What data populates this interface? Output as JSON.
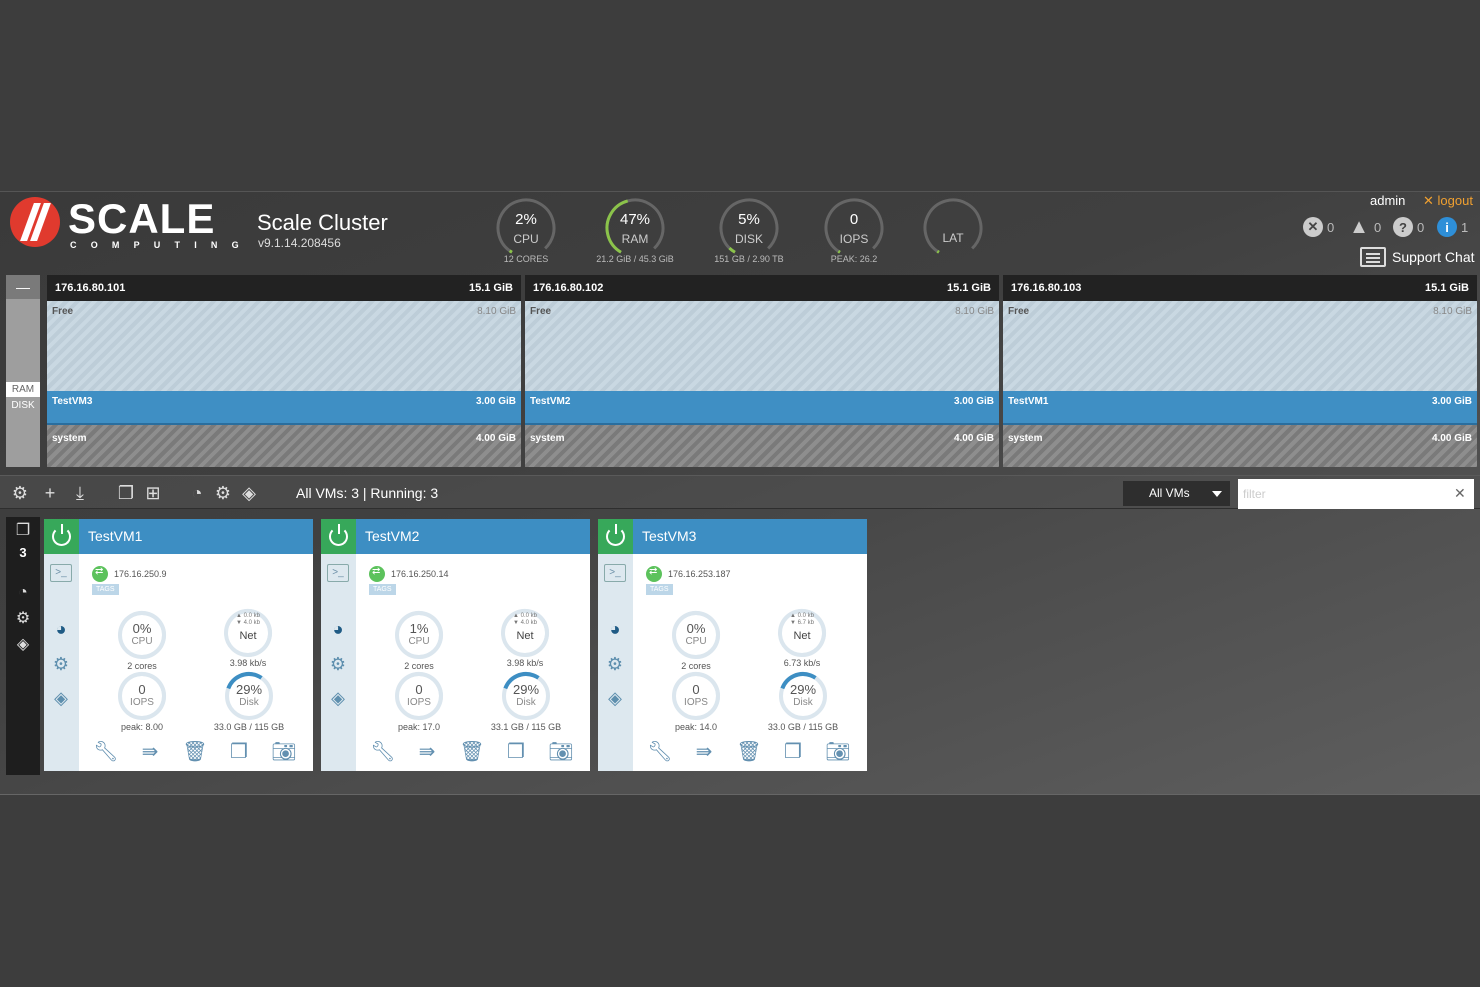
{
  "brand": {
    "name": "SCALE",
    "sub": "COMPUTING"
  },
  "cluster": {
    "name": "Scale Cluster",
    "version": "v9.1.14.208456"
  },
  "gauges": [
    {
      "id": "cpu",
      "value": "2%",
      "label": "CPU",
      "sub": "12 CORES",
      "fraction": 0.02
    },
    {
      "id": "ram",
      "value": "47%",
      "label": "RAM",
      "sub": "21.2 GiB / 45.3 GiB",
      "fraction": 0.47
    },
    {
      "id": "disk",
      "value": "5%",
      "label": "DISK",
      "sub": "151 GB / 2.90 TB",
      "fraction": 0.05
    },
    {
      "id": "iops",
      "value": "0",
      "label": "IOPS",
      "sub": "PEAK: 26.2",
      "fraction": 0.0
    },
    {
      "id": "lat",
      "value": "",
      "label": "LAT",
      "sub": "",
      "fraction": 0.0
    }
  ],
  "user": {
    "name": "admin",
    "logout": "logout"
  },
  "alerts": {
    "errors": "0",
    "warnings": "0",
    "questions": "0",
    "info": "1"
  },
  "support": {
    "label": "Support Chat"
  },
  "ram_panel": {
    "tabs": {
      "collapse": "—",
      "ram": "RAM",
      "disk": "DISK"
    },
    "nodes": [
      {
        "ip": "176.16.80.101",
        "total": "15.1 GiB",
        "free_label": "Free",
        "free": "8.10 GiB",
        "vm": "TestVM3",
        "vm_size": "3.00 GiB",
        "sys_label": "system",
        "sys": "4.00 GiB"
      },
      {
        "ip": "176.16.80.102",
        "total": "15.1 GiB",
        "free_label": "Free",
        "free": "8.10 GiB",
        "vm": "TestVM2",
        "vm_size": "3.00 GiB",
        "sys_label": "system",
        "sys": "4.00 GiB"
      },
      {
        "ip": "176.16.80.103",
        "total": "15.1 GiB",
        "free_label": "Free",
        "free": "8.10 GiB",
        "vm": "TestVM1",
        "vm_size": "3.00 GiB",
        "sys_label": "system",
        "sys": "4.00 GiB"
      }
    ]
  },
  "toolbar": {
    "summary": "All VMs: 3 | Running: 3",
    "select_value": "All VMs",
    "filter_placeholder": "filter",
    "filter_clear": "✕"
  },
  "strip": {
    "count": "3"
  },
  "vms": [
    {
      "name": "TestVM1",
      "ip": "176.16.250.9",
      "tags": "TAGS",
      "cpu": "0%",
      "cpu_label": "CPU",
      "cores": "2 cores",
      "net_up": "▲ 0.0 kb",
      "net_down": "▼ 4.0 kb",
      "net_label": "Net",
      "net_rate": "3.98 kb/s",
      "iops": "0",
      "iops_label": "IOPS",
      "iops_peak": "peak: 8.00",
      "disk": "29%",
      "disk_label": "Disk",
      "disk_usage": "33.0 GB / 115 GB",
      "disk_fraction": 0.29
    },
    {
      "name": "TestVM2",
      "ip": "176.16.250.14",
      "tags": "TAGS",
      "cpu": "1%",
      "cpu_label": "CPU",
      "cores": "2 cores",
      "net_up": "▲ 0.0 kb",
      "net_down": "▼ 4.0 kb",
      "net_label": "Net",
      "net_rate": "3.98 kb/s",
      "iops": "0",
      "iops_label": "IOPS",
      "iops_peak": "peak: 17.0",
      "disk": "29%",
      "disk_label": "Disk",
      "disk_usage": "33.1 GB / 115 GB",
      "disk_fraction": 0.29
    },
    {
      "name": "TestVM3",
      "ip": "176.16.253.187",
      "tags": "TAGS",
      "cpu": "0%",
      "cpu_label": "CPU",
      "cores": "2 cores",
      "net_up": "▲ 0.0 kb",
      "net_down": "▼ 6.7 kb",
      "net_label": "Net",
      "net_rate": "6.73 kb/s",
      "iops": "0",
      "iops_label": "IOPS",
      "iops_peak": "peak: 14.0",
      "disk": "29%",
      "disk_label": "Disk",
      "disk_usage": "33.0 GB / 115 GB",
      "disk_fraction": 0.29
    }
  ],
  "colors": {
    "accent": "#3d8ec3",
    "power": "#37a85a",
    "gauge_arc": "#8bc34a",
    "logo": "#e03a2e",
    "logout": "#f0a030"
  }
}
